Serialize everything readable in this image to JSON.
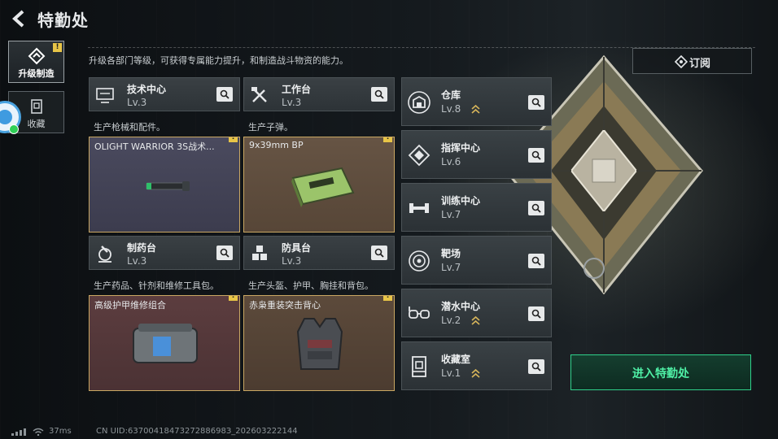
{
  "header": {
    "title": "特勤处"
  },
  "sidebar": {
    "tabs": [
      {
        "label": "升级制造",
        "badge": "!"
      },
      {
        "label": "收藏"
      }
    ]
  },
  "subtitle": "升级各部门等级，可获得专属能力提升，和制造战斗物资的能力。",
  "subscribe": {
    "label": "订阅"
  },
  "workshops": [
    {
      "name": "技术中心",
      "level": "Lv.3",
      "desc": "生产枪械和配件。",
      "item": "OLIGHT WARRIOR 3S战术...",
      "badge": "!"
    },
    {
      "name": "工作台",
      "level": "Lv.3",
      "desc": "生产子弹。",
      "item": "9x39mm BP",
      "badge": "!"
    },
    {
      "name": "制药台",
      "level": "Lv.3",
      "desc": "生产药品、针剂和维修工具包。",
      "item": "高级护甲维修组合",
      "badge": "!"
    },
    {
      "name": "防具台",
      "level": "Lv.3",
      "desc": "生产头盔、护甲、胸挂和背包。",
      "item": "赤枭重装突击背心",
      "badge": "!"
    }
  ],
  "stations": [
    {
      "name": "仓库",
      "level": "Lv.8",
      "upgradable": true
    },
    {
      "name": "指挥中心",
      "level": "Lv.6",
      "upgradable": false
    },
    {
      "name": "训练中心",
      "level": "Lv.7",
      "upgradable": false
    },
    {
      "name": "靶场",
      "level": "Lv.7",
      "upgradable": false
    },
    {
      "name": "潜水中心",
      "level": "Lv.2",
      "upgradable": true
    },
    {
      "name": "收藏室",
      "level": "Lv.1",
      "upgradable": true
    }
  ],
  "enter": {
    "label": "进入特勤处"
  },
  "footer": {
    "ping": "37ms",
    "uid": "CN UID:6370041847327288698З_202603222144"
  },
  "colors": {
    "accent_green": "#4ff0a6",
    "badge_yellow": "#e8c547",
    "upgrade_gold": "#d6b45a"
  }
}
